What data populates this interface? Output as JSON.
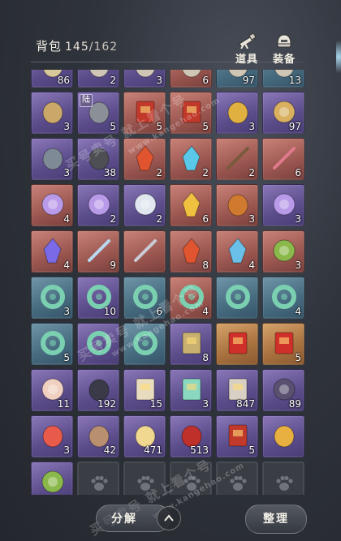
{
  "header": {
    "title": "背包",
    "count": "145",
    "capacity": "/162",
    "tools_label": "道具",
    "equipment_label": "装备"
  },
  "slots": [
    {
      "quality": "purple",
      "icon": "scroll-icon",
      "qty": "86"
    },
    {
      "quality": "purple",
      "icon": "item-icon",
      "qty": "2"
    },
    {
      "quality": "purple",
      "icon": "item-icon",
      "qty": "3"
    },
    {
      "quality": "red",
      "icon": "item-icon",
      "qty": "6"
    },
    {
      "quality": "blue",
      "icon": "item-icon",
      "qty": "97"
    },
    {
      "quality": "blue",
      "icon": "item-icon",
      "qty": "13"
    },
    {
      "quality": "purple",
      "icon": "scroll-roll-icon",
      "qty": "3"
    },
    {
      "quality": "purple",
      "icon": "helmet-icon",
      "qty": "5",
      "tag": "陆"
    },
    {
      "quality": "red",
      "icon": "banner-icon",
      "qty": "5"
    },
    {
      "quality": "red",
      "icon": "banner-icon",
      "qty": "5"
    },
    {
      "quality": "purple",
      "icon": "gift-bundle-icon",
      "qty": "3"
    },
    {
      "quality": "purple",
      "icon": "compass-icon",
      "qty": "97"
    },
    {
      "quality": "purple",
      "icon": "stone-icon",
      "qty": "3"
    },
    {
      "quality": "purple",
      "icon": "ore-icon",
      "qty": "38"
    },
    {
      "quality": "red",
      "icon": "fire-crystal-icon",
      "qty": "2"
    },
    {
      "quality": "red",
      "icon": "ice-shard-icon",
      "qty": "2"
    },
    {
      "quality": "red",
      "icon": "brush-icon",
      "qty": "2"
    },
    {
      "quality": "red",
      "icon": "plum-branch-icon",
      "qty": "6"
    },
    {
      "quality": "red",
      "icon": "rune-disc-icon",
      "qty": "4"
    },
    {
      "quality": "purple",
      "icon": "rune-disc-icon",
      "qty": "2"
    },
    {
      "quality": "purple",
      "icon": "pearl-icon",
      "qty": "2"
    },
    {
      "quality": "red",
      "icon": "gold-crystal-icon",
      "qty": "6"
    },
    {
      "quality": "red",
      "icon": "hammer-icon",
      "qty": "3"
    },
    {
      "quality": "purple",
      "icon": "rune-disc-icon",
      "qty": "3"
    },
    {
      "quality": "red",
      "icon": "violet-flame-icon",
      "qty": "4"
    },
    {
      "quality": "red",
      "icon": "feather-icon",
      "qty": "9"
    },
    {
      "quality": "red",
      "icon": "dagger-icon",
      "qty": ""
    },
    {
      "quality": "red",
      "icon": "fire-crystal-icon",
      "qty": "8"
    },
    {
      "quality": "red",
      "icon": "ice-crystal-icon",
      "qty": "4"
    },
    {
      "quality": "red",
      "icon": "wreath-icon",
      "qty": "3"
    },
    {
      "quality": "blue",
      "icon": "jade-ring-icon",
      "qty": "3"
    },
    {
      "quality": "purple",
      "icon": "jade-ring-icon",
      "qty": "10"
    },
    {
      "quality": "blue",
      "icon": "jade-ring-icon",
      "qty": "6"
    },
    {
      "quality": "red",
      "icon": "jade-ring-icon",
      "qty": "4"
    },
    {
      "quality": "blue",
      "icon": "jade-ring-icon",
      "qty": ""
    },
    {
      "quality": "blue",
      "icon": "jade-ring-icon",
      "qty": "4"
    },
    {
      "quality": "blue",
      "icon": "jade-ring-icon",
      "qty": "5"
    },
    {
      "quality": "purple",
      "icon": "jade-ring-icon",
      "qty": ""
    },
    {
      "quality": "blue",
      "icon": "jade-ring-icon",
      "qty": ""
    },
    {
      "quality": "purple",
      "icon": "painting-icon",
      "qty": "8"
    },
    {
      "quality": "gold",
      "icon": "red-envelope-icon",
      "qty": ""
    },
    {
      "quality": "gold",
      "icon": "red-envelope-icon",
      "qty": "5"
    },
    {
      "quality": "purple",
      "icon": "orb-icon",
      "qty": "11"
    },
    {
      "quality": "purple",
      "icon": "figure-icon",
      "qty": "192"
    },
    {
      "quality": "purple",
      "icon": "book-stack-icon",
      "qty": "15"
    },
    {
      "quality": "purple",
      "icon": "jade-box-icon",
      "qty": "3"
    },
    {
      "quality": "purple",
      "icon": "scroll-stack-icon",
      "qty": "847"
    },
    {
      "quality": "purple",
      "icon": "plate-icon",
      "qty": "89"
    },
    {
      "quality": "purple",
      "icon": "lotus-icon",
      "qty": "3"
    },
    {
      "quality": "purple",
      "icon": "dragonfly-icon",
      "qty": "42"
    },
    {
      "quality": "purple",
      "icon": "paper-crane-icon",
      "qty": "471"
    },
    {
      "quality": "purple",
      "icon": "red-gourd-icon",
      "qty": "513"
    },
    {
      "quality": "purple",
      "icon": "banner-icon",
      "qty": "5"
    },
    {
      "quality": "purple",
      "icon": "gold-egg-icon",
      "qty": ""
    },
    {
      "quality": "purple",
      "icon": "wreath-icon",
      "qty": ""
    },
    {
      "quality": "empty",
      "icon": "paw-icon",
      "qty": ""
    },
    {
      "quality": "empty",
      "icon": "paw-icon",
      "qty": ""
    },
    {
      "quality": "empty",
      "icon": "paw-icon",
      "qty": ""
    },
    {
      "quality": "empty",
      "icon": "paw-icon",
      "qty": ""
    },
    {
      "quality": "empty",
      "icon": "paw-icon",
      "qty": ""
    }
  ],
  "footer": {
    "decompose_label": "分解",
    "arrange_label": "整理"
  },
  "watermarks": {
    "cn_text": "买号卖号 就上看个号",
    "url_text": "www.kangehao.com"
  },
  "colors": {
    "purple": "#6a5a9c",
    "red": "#9a5650",
    "blue": "#466a7e",
    "gold": "#a8713f",
    "empty": "#3a3d44"
  }
}
